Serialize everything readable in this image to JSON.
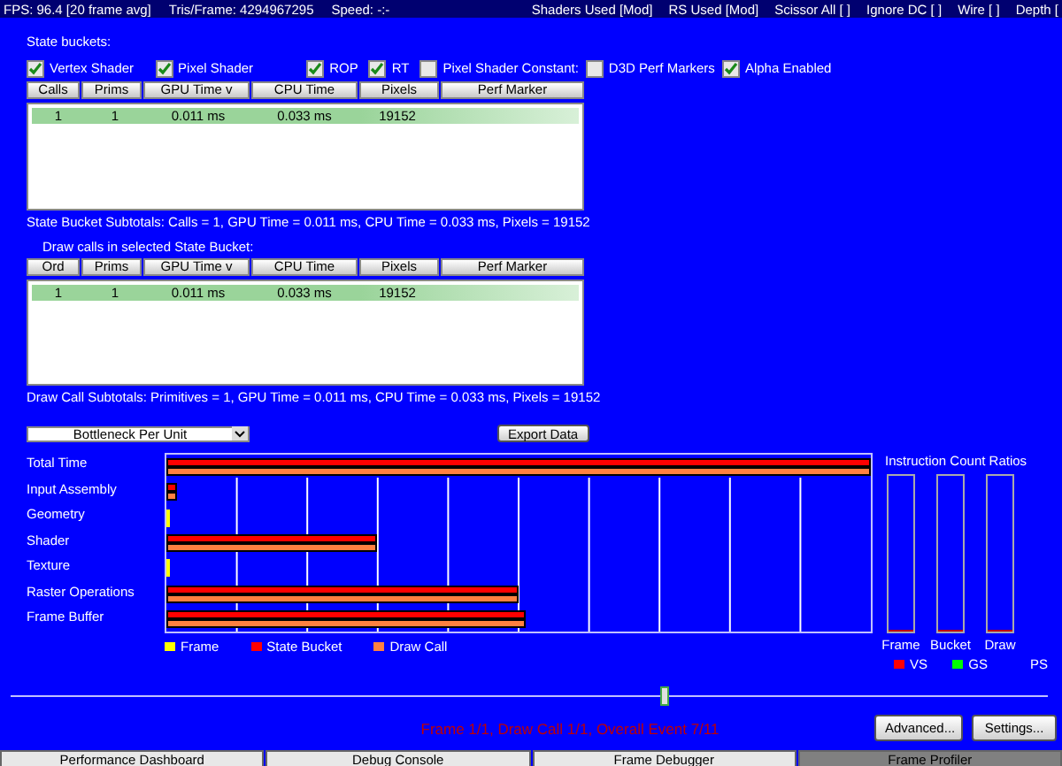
{
  "status_bar": {
    "left": [
      "FPS: 96.4 [20 frame avg]",
      "Tris/Frame: 4294967295",
      "Speed:  -:-"
    ],
    "right": [
      "Shaders Used [Mod]",
      "RS Used [Mod]",
      "Scissor All [ ]",
      "Ignore DC [ ]",
      "Wire [ ]",
      "Depth ["
    ]
  },
  "state_buckets": {
    "label": "State buckets:",
    "filters": [
      {
        "label": "Vertex Shader",
        "checked": true
      },
      {
        "label": "Pixel Shader",
        "checked": true
      },
      {
        "label": "ROP",
        "checked": true
      },
      {
        "label": "RT",
        "checked": true
      },
      {
        "label": "Pixel Shader Constant:",
        "checked": false
      },
      {
        "label": "D3D Perf Markers",
        "checked": false
      },
      {
        "label": "Alpha Enabled",
        "checked": true
      }
    ],
    "table": {
      "columns": [
        "Calls",
        "Prims",
        "GPU Time  v",
        "CPU Time",
        "Pixels",
        "Perf Marker"
      ],
      "rows": [
        {
          "cells": [
            "1",
            "1",
            "0.011 ms",
            "0.033 ms",
            "19152",
            ""
          ],
          "selected": true
        }
      ]
    },
    "subtotals": "State Bucket Subtotals: Calls = 1, GPU Time = 0.011 ms, CPU Time = 0.033 ms, Pixels = 19152"
  },
  "draw_calls": {
    "label": "Draw calls in selected State Bucket:",
    "table": {
      "columns": [
        "Ord",
        "Prims",
        "GPU Time  v",
        "CPU Time",
        "Pixels",
        "Perf Marker"
      ],
      "rows": [
        {
          "cells": [
            "1",
            "1",
            "0.011 ms",
            "0.033 ms",
            "19152",
            ""
          ],
          "selected": true
        }
      ]
    },
    "subtotals": "Draw Call Subtotals: Primitives = 1, GPU Time = 0.011 ms, CPU Time = 0.033 ms, Pixels = 19152"
  },
  "view_select": {
    "value": "Bottleneck Per Unit"
  },
  "export_button": "Export Data",
  "bottleneck": {
    "rows": [
      {
        "label": "Total Time",
        "bars": [
          {
            "kind": "state_bucket",
            "level": 1
          },
          {
            "kind": "draw_call",
            "level": 1
          }
        ]
      },
      {
        "label": "Input Assembly",
        "bars": [
          {
            "kind": "state_bucket",
            "level": 0.016
          },
          {
            "kind": "draw_call",
            "level": 0.016
          }
        ]
      },
      {
        "label": "Geometry",
        "bars": [
          {
            "kind": "frame",
            "level": 0.003
          }
        ]
      },
      {
        "label": "Shader",
        "bars": [
          {
            "kind": "state_bucket",
            "level": 0.298
          },
          {
            "kind": "draw_call",
            "level": 0.298
          }
        ]
      },
      {
        "label": "Texture",
        "bars": [
          {
            "kind": "frame",
            "level": 0.003
          }
        ]
      },
      {
        "label": "Raster Operations",
        "bars": [
          {
            "kind": "state_bucket",
            "level": 0.5
          },
          {
            "kind": "draw_call",
            "level": 0.5
          }
        ]
      },
      {
        "label": "Frame Buffer",
        "bars": [
          {
            "kind": "state_bucket",
            "level": 0.51
          },
          {
            "kind": "draw_call",
            "level": 0.51
          }
        ]
      }
    ],
    "legend": [
      {
        "label": "Frame",
        "color": "#ffff00"
      },
      {
        "label": "State Bucket",
        "color": "#ff0000"
      },
      {
        "label": "Draw Call",
        "color": "#ff8040"
      }
    ]
  },
  "instruction_ratios": {
    "title": "Instruction Count Ratios",
    "meters": [
      {
        "label": "Frame",
        "level": 0.01
      },
      {
        "label": "Bucket",
        "level": 0.01
      },
      {
        "label": "Draw",
        "level": 0.01
      }
    ],
    "legend": [
      {
        "label": "VS",
        "color": "#ff0000"
      },
      {
        "label": "GS",
        "color": "#00ff00"
      },
      {
        "label": "PS"
      }
    ]
  },
  "timeline": {
    "level": 0.63
  },
  "event_status": "Frame 1/1, Draw Call 1/1, Overall Event 7/11",
  "buttons": [
    "Advanced...",
    "Settings..."
  ],
  "tabs": [
    {
      "label": "Performance Dashboard",
      "selected": false
    },
    {
      "label": "Debug Console",
      "selected": false
    },
    {
      "label": "Frame Debugger",
      "selected": false
    },
    {
      "label": "Frame Profiler",
      "selected": true
    }
  ]
}
